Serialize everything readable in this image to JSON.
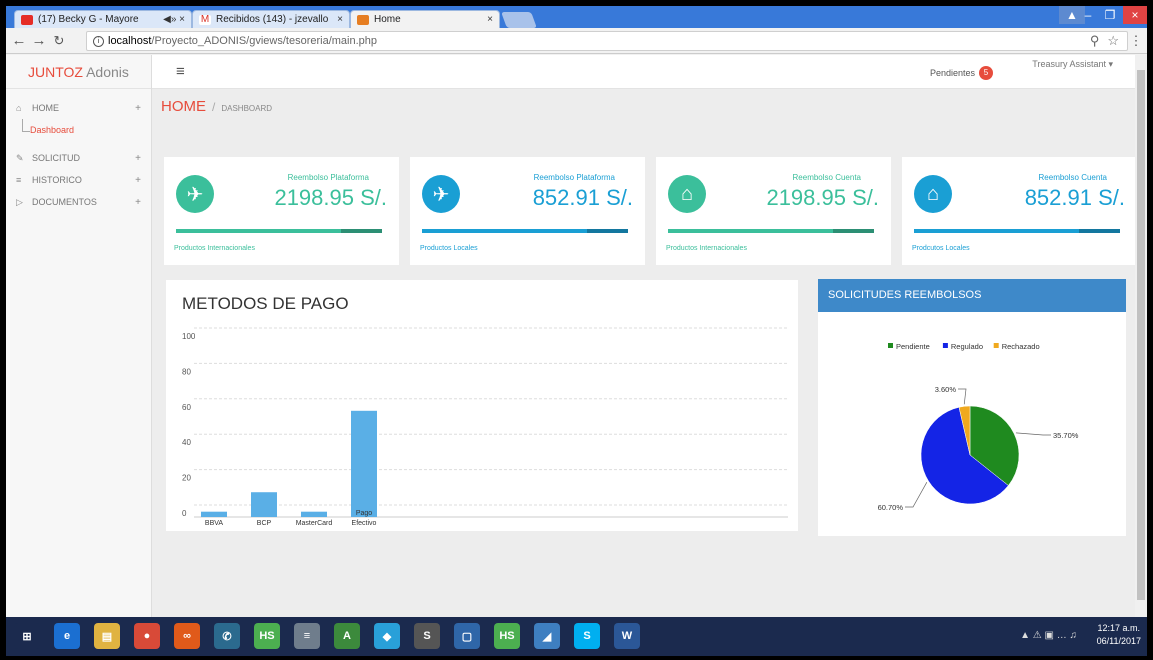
{
  "browser": {
    "tabs": [
      {
        "label": "(17) Becky G - Mayore",
        "extra": "◀» ×"
      },
      {
        "label": "Recibidos (143) - jzevallo",
        "extra": "×"
      },
      {
        "label": "Home",
        "extra": "×"
      }
    ],
    "url_host": "localhost",
    "url_path": "/Proyecto_ADONIS/gviews/tesoreria/main.php"
  },
  "app": {
    "brand_main": "JUNTOZ",
    "brand_rest": " Adonis",
    "pendientes_label": "Pendientes",
    "pendientes_count": "5",
    "user": "Treasury Assistant ▾",
    "breadcrumb_home": "HOME",
    "breadcrumb_sep": "/",
    "breadcrumb_sub": "DASHBOARD"
  },
  "sidebar": {
    "items": [
      {
        "icon": "⌂",
        "label": "HOME"
      },
      {
        "icon": "✎",
        "label": "SOLICITUD"
      },
      {
        "icon": "≡",
        "label": "HISTORICO"
      },
      {
        "icon": "▷",
        "label": "DOCUMENTOS"
      }
    ],
    "sub_label": "Dashboard",
    "plus": "+"
  },
  "stats": [
    {
      "title": "Reembolso Plataforma",
      "value": "2198.95 S/.",
      "foot": "Productos Internacionales",
      "icon": "plane-icon",
      "color": "#3bbf9b",
      "fill": 0.8
    },
    {
      "title": "Reembolso Plataforma",
      "value": "852.91 S/.",
      "foot": "Productos Locales",
      "icon": "plane-icon",
      "color": "#1a9fd4",
      "fill": 0.8
    },
    {
      "title": "Reembolso Cuenta",
      "value": "2198.95 S/.",
      "foot": "Productos Internacionales",
      "icon": "home-icon",
      "color": "#3bbf9b",
      "fill": 0.8
    },
    {
      "title": "Reembolso Cuenta",
      "value": "852.91 S/.",
      "foot": "Prodcutos Locales",
      "icon": "home-icon",
      "color": "#1a9fd4",
      "fill": 0.8
    }
  ],
  "bar_panel_title": "METODOS DE PAGO",
  "pie_panel_title": "SOLICITUDES REEMBOLSOS",
  "chart_data": [
    {
      "type": "bar",
      "title": "METODOS DE PAGO",
      "categories": [
        "BBVA",
        "BCP",
        "MasterCard",
        "Pago Efectivo"
      ],
      "values": [
        3,
        14,
        3,
        60
      ],
      "ylim": [
        0,
        100
      ],
      "yticks": [
        0,
        20,
        40,
        60,
        80,
        100
      ],
      "grid": true,
      "color": "#5aafe6"
    },
    {
      "type": "pie",
      "title": "SOLICITUDES REEMBOLSOS",
      "labels": [
        "Pendiente",
        "Regulado",
        "Rechazado"
      ],
      "values": [
        35.7,
        60.7,
        3.6
      ],
      "value_labels": [
        "35.70%",
        "60.70%",
        "3.60%"
      ],
      "colors": [
        "#1f8a1f",
        "#1424e6",
        "#f0a91e"
      ],
      "legend": "top"
    }
  ],
  "taskbar": {
    "time": "12:17 a.m.",
    "date": "06/11/2017",
    "icons": [
      {
        "name": "start-icon",
        "glyph": "⊞",
        "bg": "#1b2a4e"
      },
      {
        "name": "ie-icon",
        "glyph": "e",
        "bg": "#1b6fd1"
      },
      {
        "name": "explorer-icon",
        "glyph": "▤",
        "bg": "#e0b341"
      },
      {
        "name": "chrome-icon",
        "glyph": "●",
        "bg": "#d84a38"
      },
      {
        "name": "xampp-icon",
        "glyph": "∞",
        "bg": "#e05a1a"
      },
      {
        "name": "tool-icon",
        "glyph": "✆",
        "bg": "#2b6a8e"
      },
      {
        "name": "hs-icon",
        "glyph": "HS",
        "bg": "#4caf50"
      },
      {
        "name": "calculator-icon",
        "glyph": "≡",
        "bg": "#6f7d8c"
      },
      {
        "name": "android-icon",
        "glyph": "A",
        "bg": "#3c8a3c"
      },
      {
        "name": "git-icon",
        "glyph": "◆",
        "bg": "#29a0d9"
      },
      {
        "name": "sublime-icon",
        "glyph": "S",
        "bg": "#555"
      },
      {
        "name": "virtualbox-icon",
        "glyph": "▢",
        "bg": "#2f66a8"
      },
      {
        "name": "hs2-icon",
        "glyph": "HS",
        "bg": "#4caf50"
      },
      {
        "name": "android-studio-icon",
        "glyph": "◢",
        "bg": "#3e7fc1"
      },
      {
        "name": "skype-icon",
        "glyph": "S",
        "bg": "#00aff0"
      },
      {
        "name": "word-icon",
        "glyph": "W",
        "bg": "#2b5797"
      }
    ]
  }
}
